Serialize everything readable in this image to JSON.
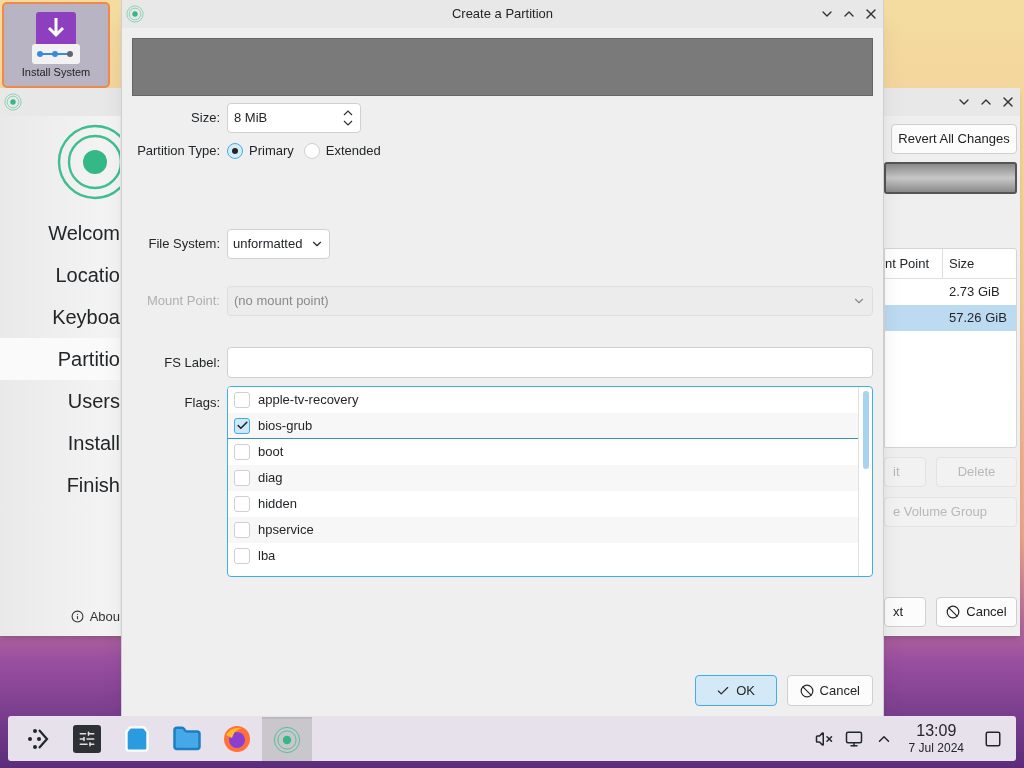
{
  "desktop": {
    "icons": [
      {
        "label": "Install System",
        "selected": true
      }
    ]
  },
  "installer_window": {
    "sidebar": {
      "steps": [
        {
          "label": "Welcom",
          "selected": false
        },
        {
          "label": "Locatio",
          "selected": false
        },
        {
          "label": "Keyboa",
          "selected": false
        },
        {
          "label": "Partitio",
          "selected": true
        },
        {
          "label": "Users",
          "selected": false
        },
        {
          "label": "Install",
          "selected": false
        },
        {
          "label": "Finish",
          "selected": false
        }
      ],
      "about": "Abou"
    },
    "revert_button": "Revert All Changes",
    "table": {
      "columns": [
        "nt Point",
        "Size"
      ],
      "rows": [
        {
          "size": "2.73 GiB",
          "selected": false
        },
        {
          "size": "57.26 GiB",
          "selected": true
        }
      ]
    },
    "action_buttons": [
      {
        "label": "it",
        "disabled": true
      },
      {
        "label": "Delete",
        "disabled": true
      },
      {
        "label": "e Volume Group",
        "disabled": true
      }
    ],
    "footer_buttons": [
      {
        "label": "xt",
        "kind": "next"
      },
      {
        "label": "Cancel",
        "kind": "cancel"
      }
    ]
  },
  "dialog": {
    "title": "Create a Partition",
    "size": {
      "label": "Size:",
      "value": "8 MiB"
    },
    "partition_type": {
      "label": "Partition Type:",
      "options": [
        {
          "label": "Primary",
          "selected": true
        },
        {
          "label": "Extended",
          "selected": false
        }
      ]
    },
    "file_system": {
      "label": "File System:",
      "value": "unformatted"
    },
    "mount_point": {
      "label": "Mount Point:",
      "placeholder": "(no mount point)",
      "disabled": true
    },
    "fs_label": {
      "label": "FS Label:"
    },
    "flags": {
      "label": "Flags:",
      "items": [
        {
          "label": "apple-tv-recovery",
          "checked": false
        },
        {
          "label": "bios-grub",
          "checked": true
        },
        {
          "label": "boot",
          "checked": false
        },
        {
          "label": "diag",
          "checked": false
        },
        {
          "label": "hidden",
          "checked": false
        },
        {
          "label": "hpservice",
          "checked": false
        },
        {
          "label": "lba",
          "checked": false
        }
      ]
    },
    "buttons": [
      {
        "label": "OK",
        "kind": "ok"
      },
      {
        "label": "Cancel",
        "kind": "cancel"
      }
    ]
  },
  "taskbar": {
    "apps": [
      {
        "kind": "launcher",
        "selected": false
      },
      {
        "kind": "settings",
        "selected": false
      },
      {
        "kind": "store",
        "selected": false
      },
      {
        "kind": "files",
        "selected": false
      },
      {
        "kind": "browser",
        "selected": false
      },
      {
        "kind": "installer",
        "selected": true
      }
    ],
    "clock": {
      "time": "13:09",
      "date": "7 Jul 2024"
    }
  }
}
